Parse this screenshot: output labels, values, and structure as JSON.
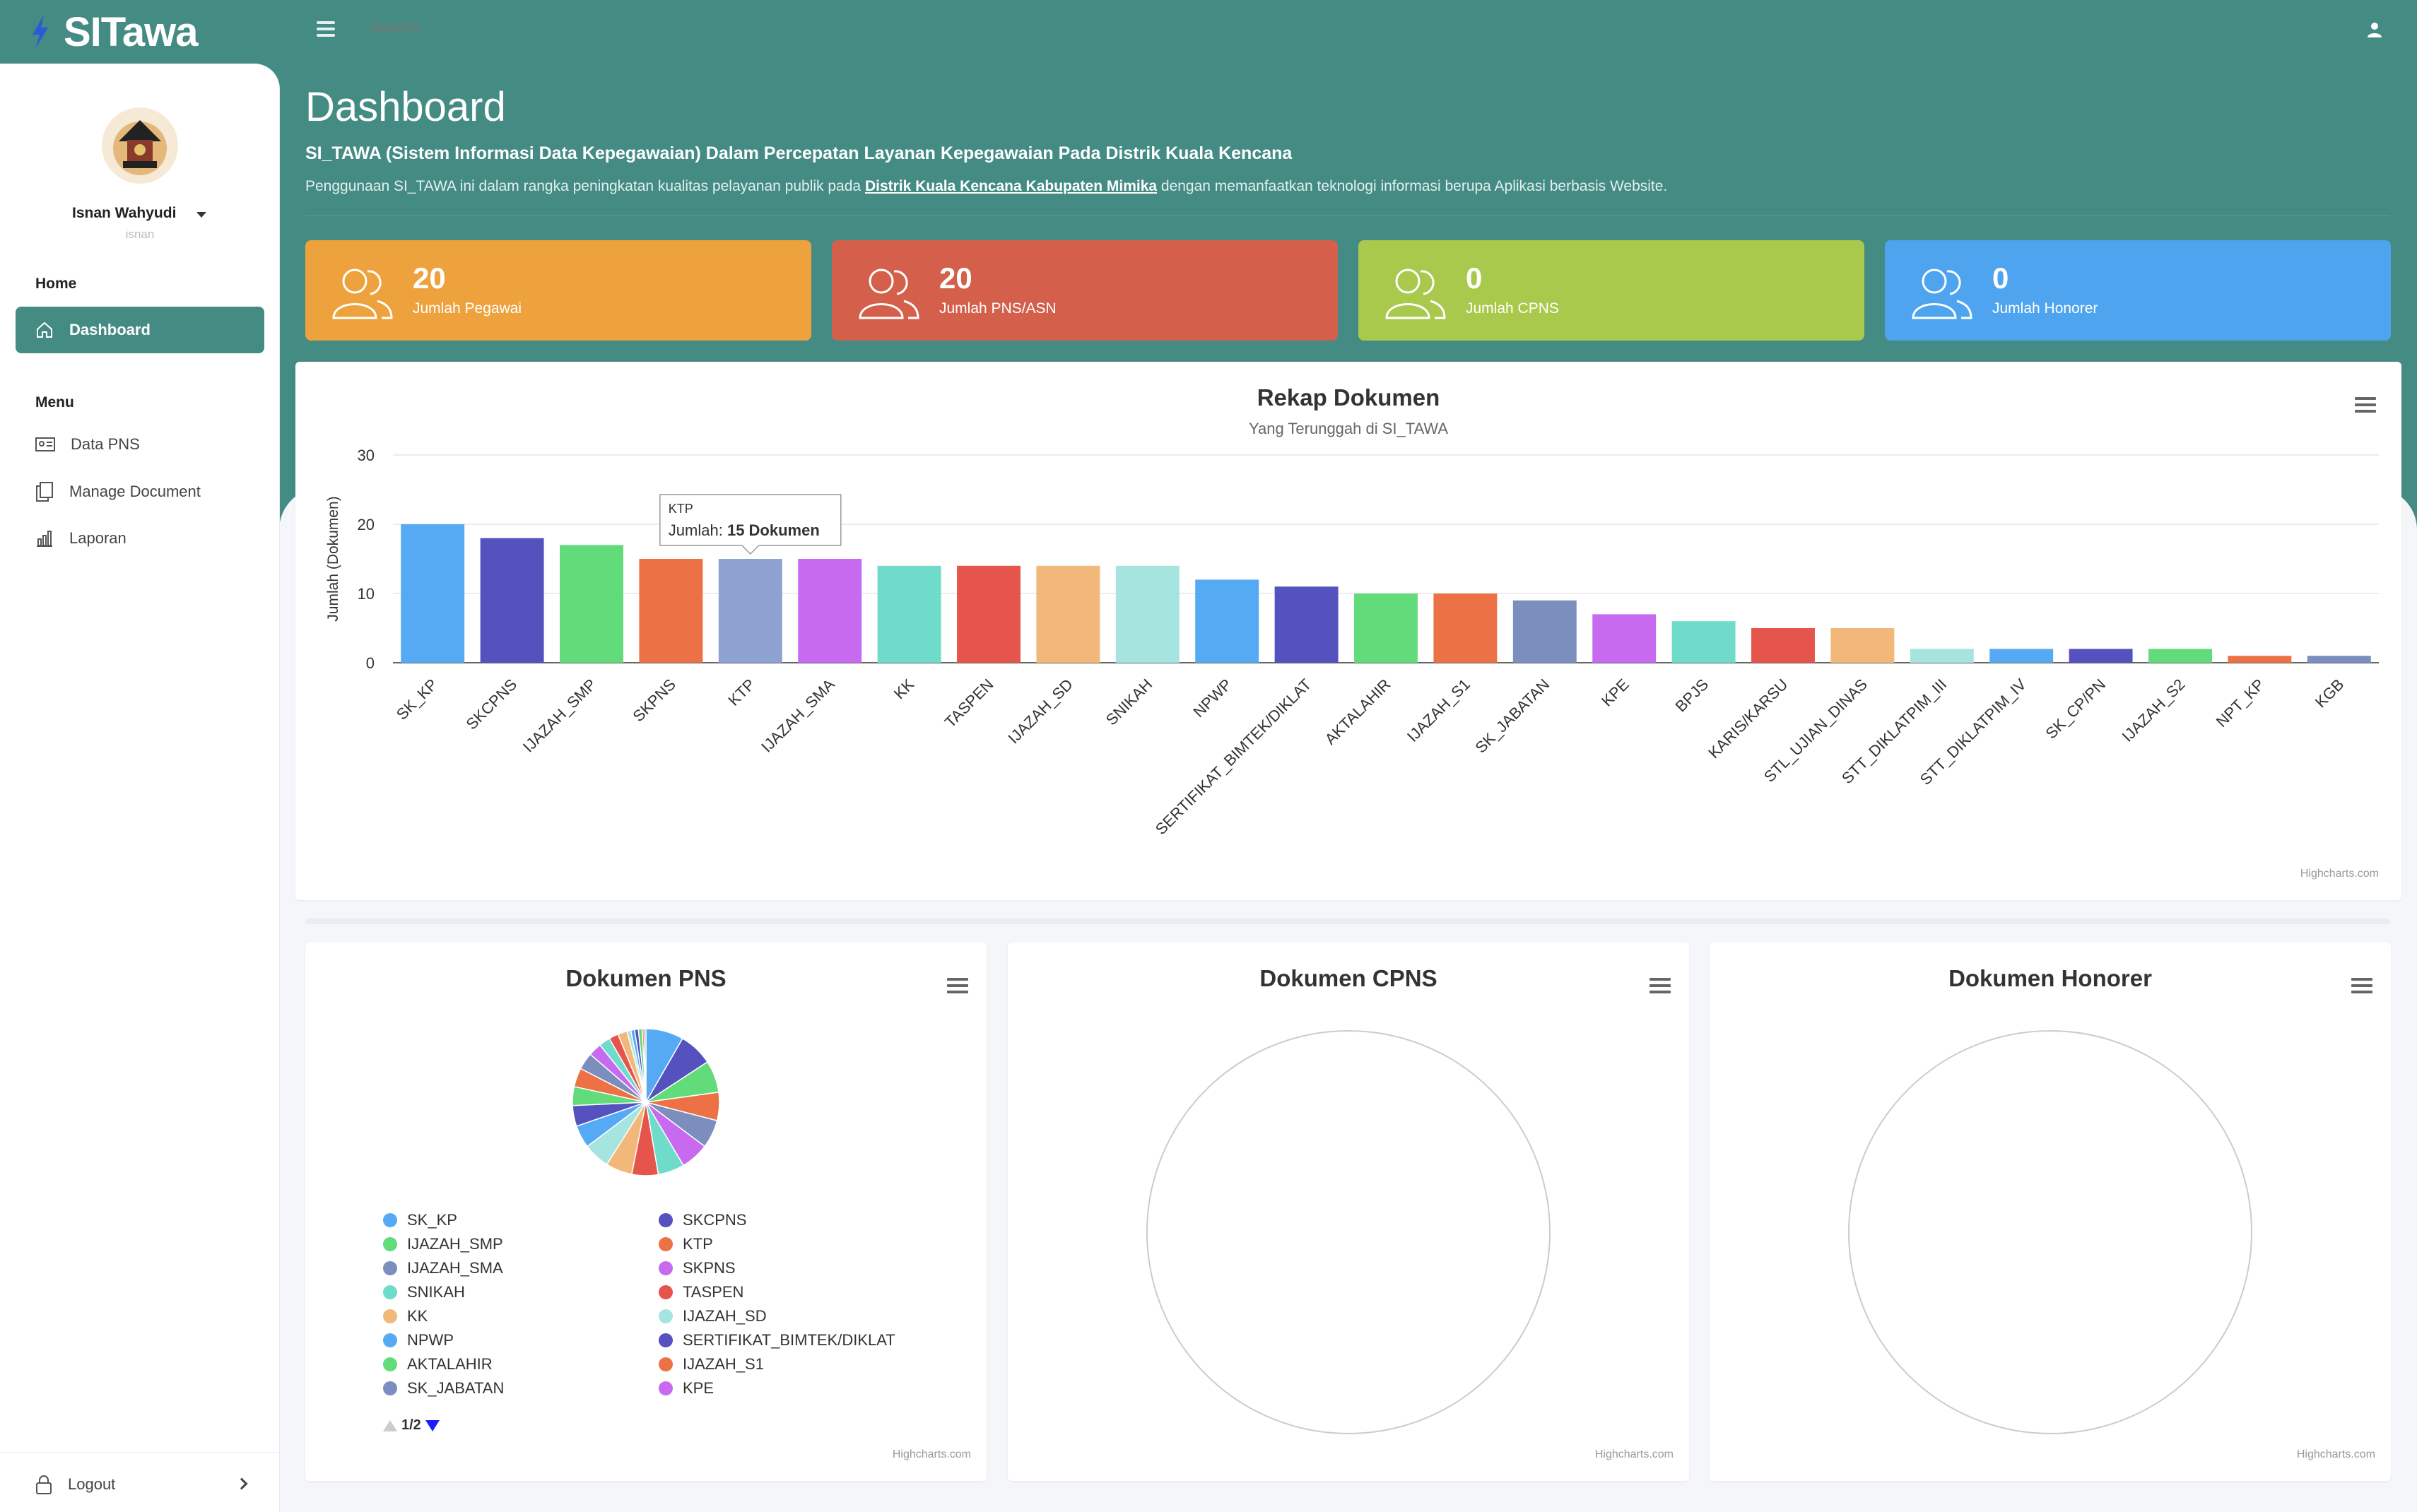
{
  "app": {
    "name": "SITawa"
  },
  "topbar": {
    "search_placeholder": "Search . . ."
  },
  "user": {
    "name": "Isnan Wahyudi",
    "username": "isnan"
  },
  "sidebar": {
    "home_heading": "Home",
    "active_item": "Dashboard",
    "menu_heading": "Menu",
    "items": [
      {
        "label": "Data PNS",
        "icon": "id-card-icon"
      },
      {
        "label": "Manage Document",
        "icon": "documents-icon"
      },
      {
        "label": "Laporan",
        "icon": "bar-chart-icon"
      }
    ],
    "logout": "Logout"
  },
  "header": {
    "title": "Dashboard",
    "subtitle": "SI_TAWA (Sistem Informasi Data Kepegawaian) Dalam Percepatan Layanan Kepegawaian Pada Distrik Kuala Kencana",
    "desc_before": "Penggunaan SI_TAWA ini dalam rangka peningkatan kualitas pelayanan publik pada ",
    "desc_link": "Distrik Kuala Kencana Kabupaten Mimika",
    "desc_after": " dengan memanfaatkan teknologi informasi berupa Aplikasi berbasis Website."
  },
  "stats": [
    {
      "value": "20",
      "label": "Jumlah Pegawai",
      "color": "#eea23d"
    },
    {
      "value": "20",
      "label": "Jumlah PNS/ASN",
      "color": "#d4604c"
    },
    {
      "value": "0",
      "label": "Jumlah CPNS",
      "color": "#a8c94c"
    },
    {
      "value": "0",
      "label": "Jumlah Honorer",
      "color": "#4ea4ef"
    }
  ],
  "rekap": {
    "tooltip": {
      "category": "KTP",
      "label": "Jumlah: ",
      "value": "15 Dokumen"
    },
    "credit": "Highcharts.com"
  },
  "chart_data": [
    {
      "type": "bar",
      "title": "Rekap Dokumen",
      "subtitle": "Yang Terunggah di SI_TAWA",
      "ylabel": "Jumlah (Dokumen)",
      "ylim": [
        0,
        30
      ],
      "yticks": [
        0,
        10,
        20,
        30
      ],
      "grid": true,
      "categories": [
        "SK_KP",
        "SKCPNS",
        "IJAZAH_SMP",
        "SKPNS",
        "KTP",
        "IJAZAH_SMA",
        "KK",
        "TASPEN",
        "IJAZAH_SD",
        "SNIKAH",
        "NPWP",
        "SERTIFIKAT_BIMTEK/DIKLAT",
        "AKTALAHIR",
        "IJAZAH_S1",
        "SK_JABATAN",
        "KPE",
        "BPJS",
        "KARIS/KARSU",
        "STL_UJIAN_DINAS",
        "STT_DIKLATPIM_III",
        "STT_DIKLATPIM_IV",
        "SK_CP/PN",
        "IJAZAH_S2",
        "NPT_KP",
        "KGB"
      ],
      "values": [
        20,
        18,
        17,
        15,
        15,
        15,
        14,
        14,
        14,
        14,
        12,
        11,
        10,
        10,
        9,
        7,
        6,
        5,
        5,
        2,
        2,
        2,
        2,
        1,
        1
      ],
      "colors": [
        "#55aaf3",
        "#5552c0",
        "#62dc7a",
        "#ec7246",
        "#8ea2d2",
        "#c86af0",
        "#6fdccb",
        "#e6554c",
        "#f1b87a",
        "#a6e4df",
        "#55aaf3",
        "#5552c0",
        "#62dc7a",
        "#ec7246",
        "#7b8ebd",
        "#c86af0",
        "#6fdccb",
        "#e6554c",
        "#f1b87a",
        "#a6e4df",
        "#55aaf3",
        "#5552c0",
        "#62dc7a",
        "#ec7246",
        "#7b8ebd"
      ]
    },
    {
      "type": "pie",
      "title": "Dokumen PNS",
      "categories": [
        "SK_KP",
        "SKCPNS",
        "IJAZAH_SMP",
        "KTP",
        "IJAZAH_SMA",
        "SKPNS",
        "SNIKAH",
        "TASPEN",
        "KK",
        "IJAZAH_SD",
        "NPWP",
        "SERTIFIKAT_BIMTEK/DIKLAT",
        "AKTALAHIR",
        "IJAZAH_S1",
        "SK_JABATAN",
        "KPE",
        "BPJS",
        "KARIS/KARSU",
        "STL_UJIAN_DINAS",
        "STT_DIKLATPIM_III",
        "STT_DIKLATPIM_IV",
        "SK_CP/PN",
        "IJAZAH_S2",
        "NPT_KP",
        "KGB"
      ],
      "values": [
        20,
        18,
        17,
        15,
        15,
        15,
        14,
        14,
        14,
        14,
        12,
        11,
        10,
        10,
        9,
        7,
        6,
        5,
        5,
        2,
        2,
        2,
        2,
        1,
        1
      ],
      "colors": [
        "#55aaf3",
        "#5552c0",
        "#62dc7a",
        "#ec7246",
        "#7b8ebd",
        "#c86af0",
        "#6fdccb",
        "#e6554c",
        "#f1b87a",
        "#a6e4df",
        "#55aaf3",
        "#5552c0",
        "#62dc7a",
        "#ec7246",
        "#7b8ebd",
        "#c86af0",
        "#6fdccb",
        "#e6554c",
        "#f1b87a",
        "#a6e4df",
        "#55aaf3",
        "#5552c0",
        "#62dc7a",
        "#ec7246",
        "#7b8ebd"
      ],
      "legend": {
        "left": [
          {
            "label": "SK_KP",
            "color": "#55aaf3"
          },
          {
            "label": "IJAZAH_SMP",
            "color": "#62dc7a"
          },
          {
            "label": "IJAZAH_SMA",
            "color": "#7b8ebd"
          },
          {
            "label": "SNIKAH",
            "color": "#6fdccb"
          },
          {
            "label": "KK",
            "color": "#f1b87a"
          },
          {
            "label": "NPWP",
            "color": "#55aaf3"
          },
          {
            "label": "AKTALAHIR",
            "color": "#62dc7a"
          },
          {
            "label": "SK_JABATAN",
            "color": "#7b8ebd"
          }
        ],
        "right": [
          {
            "label": "SKCPNS",
            "color": "#5552c0"
          },
          {
            "label": "KTP",
            "color": "#ec7246"
          },
          {
            "label": "SKPNS",
            "color": "#c86af0"
          },
          {
            "label": "TASPEN",
            "color": "#e6554c"
          },
          {
            "label": "IJAZAH_SD",
            "color": "#a6e4df"
          },
          {
            "label": "SERTIFIKAT_BIMTEK/DIKLAT",
            "color": "#5552c0"
          },
          {
            "label": "IJAZAH_S1",
            "color": "#ec7246"
          },
          {
            "label": "KPE",
            "color": "#c86af0"
          }
        ],
        "pager": "1/2"
      }
    },
    {
      "type": "pie",
      "title": "Dokumen CPNS",
      "values": []
    },
    {
      "type": "pie",
      "title": "Dokumen Honorer",
      "values": []
    }
  ]
}
